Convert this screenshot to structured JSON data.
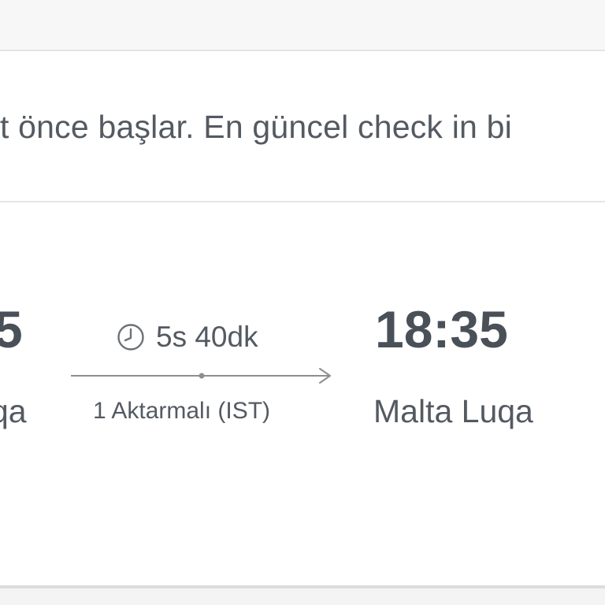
{
  "notice": {
    "text": "t önce başlar. En güncel check in bi"
  },
  "flight": {
    "departure": {
      "time": "5",
      "city": "qa"
    },
    "duration": {
      "icon": "clock-icon",
      "text": "5s 40dk"
    },
    "stops": "1 Aktarmalı (IST)",
    "arrival": {
      "time": "18:35",
      "city": "Malta Luqa"
    }
  },
  "colors": {
    "text": "#4a5058",
    "line": "#8e8e8e",
    "divider": "#e6e6e6",
    "background": "#f4f4f4",
    "card": "#ffffff"
  }
}
